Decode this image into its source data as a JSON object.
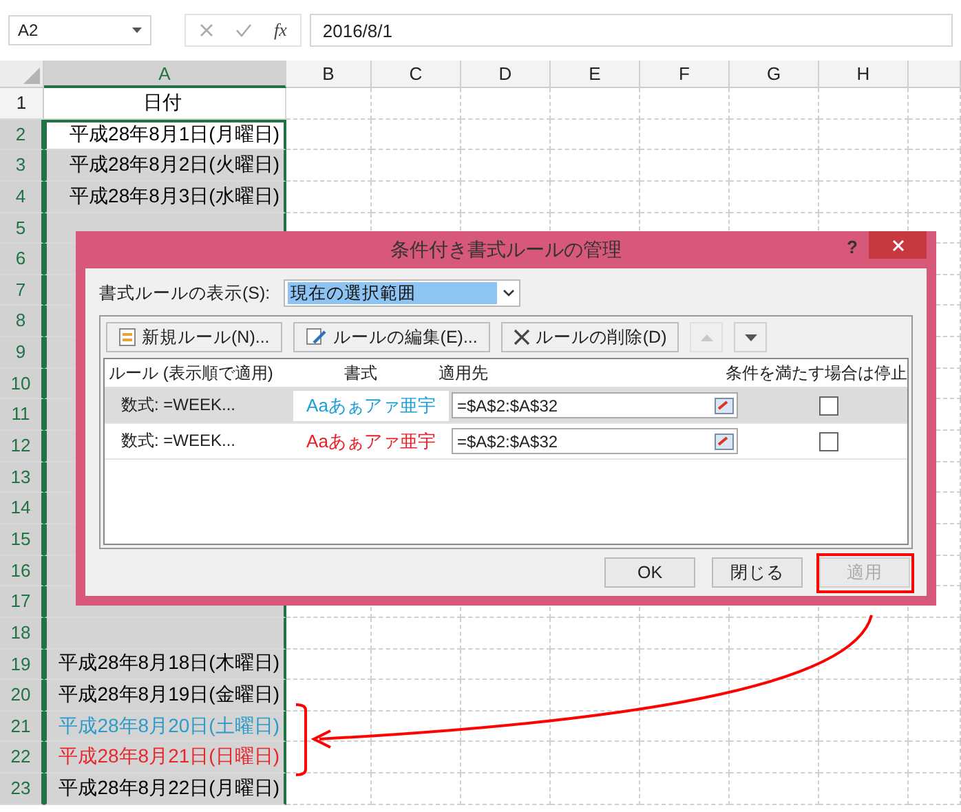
{
  "formula_bar": {
    "name_box": "A2",
    "function_label": "fx",
    "formula": "2016/8/1"
  },
  "columns": [
    {
      "label": "A",
      "selected": true
    },
    {
      "label": "B",
      "selected": false
    },
    {
      "label": "C",
      "selected": false
    },
    {
      "label": "D",
      "selected": false
    },
    {
      "label": "E",
      "selected": false
    },
    {
      "label": "F",
      "selected": false
    },
    {
      "label": "G",
      "selected": false
    },
    {
      "label": "H",
      "selected": false
    }
  ],
  "rows": [
    {
      "number": "1",
      "selected": false,
      "active": false,
      "cell": "日付",
      "kind": "header",
      "color": "#000000"
    },
    {
      "number": "2",
      "selected": true,
      "active": true,
      "cell": "平成28年8月1日(月曜日)",
      "kind": "date",
      "color": "#000000"
    },
    {
      "number": "3",
      "selected": true,
      "active": false,
      "cell": "平成28年8月2日(火曜日)",
      "kind": "date",
      "color": "#000000"
    },
    {
      "number": "4",
      "selected": true,
      "active": false,
      "cell": "平成28年8月3日(水曜日)",
      "kind": "date",
      "color": "#000000"
    },
    {
      "number": "5",
      "selected": true,
      "active": false,
      "kind": "blank"
    },
    {
      "number": "6",
      "selected": true,
      "active": false,
      "kind": "blank"
    },
    {
      "number": "7",
      "selected": true,
      "active": false,
      "kind": "blank"
    },
    {
      "number": "8",
      "selected": true,
      "active": false,
      "kind": "blank"
    },
    {
      "number": "9",
      "selected": true,
      "active": false,
      "kind": "blank"
    },
    {
      "number": "10",
      "selected": true,
      "active": false,
      "kind": "blank"
    },
    {
      "number": "11",
      "selected": true,
      "active": false,
      "kind": "blank"
    },
    {
      "number": "12",
      "selected": true,
      "active": false,
      "kind": "blank"
    },
    {
      "number": "13",
      "selected": true,
      "active": false,
      "kind": "blank"
    },
    {
      "number": "14",
      "selected": true,
      "active": false,
      "kind": "blank"
    },
    {
      "number": "15",
      "selected": true,
      "active": false,
      "kind": "blank"
    },
    {
      "number": "16",
      "selected": true,
      "active": false,
      "kind": "blank"
    },
    {
      "number": "17",
      "selected": true,
      "active": false,
      "kind": "blank"
    },
    {
      "number": "18",
      "selected": true,
      "active": false,
      "kind": "blank"
    },
    {
      "number": "19",
      "selected": true,
      "active": false,
      "cell": "平成28年8月18日(木曜日)",
      "kind": "date",
      "color": "#000000"
    },
    {
      "number": "20",
      "selected": true,
      "active": false,
      "cell": "平成28年8月19日(金曜日)",
      "kind": "date",
      "color": "#000000"
    },
    {
      "number": "21",
      "selected": true,
      "active": false,
      "cell": "平成28年8月20日(土曜日)",
      "kind": "date",
      "color": "#2a9bc9"
    },
    {
      "number": "22",
      "selected": true,
      "active": false,
      "cell": "平成28年8月21日(日曜日)",
      "kind": "date",
      "color": "#e8262a"
    },
    {
      "number": "23",
      "selected": true,
      "active": false,
      "cell": "平成28年8月22日(月曜日)",
      "kind": "date",
      "color": "#000000"
    }
  ],
  "dialog": {
    "title": "条件付き書式ルールの管理",
    "help": "?",
    "show_label": "書式ルールの表示(S):",
    "scope": "現在の選択範囲",
    "toolbar": [
      {
        "kind": "new",
        "label": "新規ルール(N)...",
        "disabled": false
      },
      {
        "kind": "edit",
        "label": "ルールの編集(E)...",
        "disabled": false
      },
      {
        "kind": "delete",
        "label": "ルールの削除(D)",
        "disabled": false
      },
      {
        "kind": "up",
        "disabled": true
      },
      {
        "kind": "down",
        "disabled": false
      }
    ],
    "columns": [
      "ルール (表示順で適用)",
      "書式",
      "適用先",
      "条件を満たす場合は停止"
    ],
    "rules": [
      {
        "rule": "数式: =WEEK...",
        "preview": "Aaあぁアァ亜宇",
        "color": "#1aa0d8",
        "applies_to": "=$A$2:$A$32",
        "stop": false,
        "selected": true
      },
      {
        "rule": "数式: =WEEK...",
        "preview": "Aaあぁアァ亜宇",
        "color": "#ee1c24",
        "applies_to": "=$A$2:$A$32",
        "stop": false,
        "selected": false
      }
    ],
    "buttons": [
      {
        "label": "OK",
        "disabled": false
      },
      {
        "label": "閉じる",
        "disabled": false
      },
      {
        "label": "適用",
        "disabled": true,
        "highlighted": true
      }
    ]
  }
}
